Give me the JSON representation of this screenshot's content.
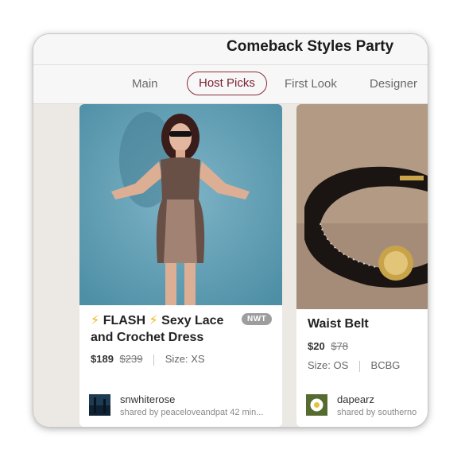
{
  "header": {
    "title": "Comeback Styles Party"
  },
  "tabs": [
    {
      "label": "Main"
    },
    {
      "label": "Host Picks",
      "active": true
    },
    {
      "label": "First Look"
    },
    {
      "label": "Designer"
    }
  ],
  "listings": [
    {
      "badge_icon": "lightning-bolt-icon",
      "title_emoji": "⚡",
      "title_flash": "FLASH",
      "title_rest": "Sexy Lace",
      "title_line2": "and Crochet Dress",
      "condition_badge": "NWT",
      "price": "$189",
      "original_price": "$239",
      "size": "Size: XS",
      "seller": "snwhiterose",
      "shared_by": "shared by peaceloveandpat 42 min..."
    },
    {
      "title": "Waist Belt",
      "price": "$20",
      "original_price": "$78",
      "size": "Size: OS",
      "brand": "BCBG",
      "seller": "dapearz",
      "shared_by": "shared by southerno"
    }
  ],
  "colors": {
    "accent": "#8a2b3b",
    "bolt": "#f2b21c",
    "background": "#ece9e4"
  }
}
